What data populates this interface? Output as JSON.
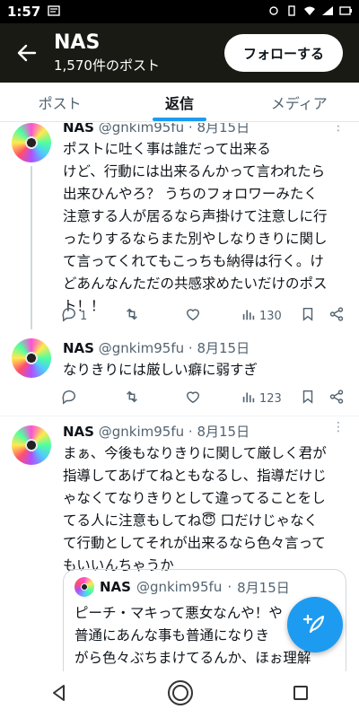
{
  "status_bar": {
    "time": "1:57"
  },
  "header": {
    "name": "NAS",
    "post_count": "1,570件のポスト",
    "follow_label": "フォローする"
  },
  "tabs": [
    {
      "label": "ポスト",
      "active": false
    },
    {
      "label": "返信",
      "active": true
    },
    {
      "label": "メディア",
      "active": false
    }
  ],
  "tweets": [
    {
      "display_name": "NAS",
      "handle": "@gnkim95fu",
      "date": "8月15日",
      "text_lines": [
        "ポストに吐く事は誰だって出来る",
        "けど、行動には出来るんかって言われたら",
        "出来ひんやろ？ うちのフォロワーみたく",
        "注意する人が居るなら声掛けて注意しに行",
        "ったりするならまた別やしなりきりに関し",
        "て言ってくれてもこっちも納得は行く。け",
        "どあんなんただの共感求めたいだけのポス",
        "ト！！"
      ],
      "replies": "1",
      "views": "130"
    },
    {
      "display_name": "NAS",
      "handle": "@gnkim95fu",
      "date": "8月15日",
      "text_lines": [
        "なりきりには厳しい癖に弱すぎ"
      ],
      "replies": "",
      "views": "123"
    },
    {
      "display_name": "NAS",
      "handle": "@gnkim95fu",
      "date": "8月15日",
      "text_lines": [
        "まぁ、今後もなりきりに関して厳しく君が",
        "指導してあげてねともなるし、指導だけじ",
        "ゃなくてなりきりとして違ってることをし",
        "てる人に注意もしてね😇 口だけじゃなく",
        "て行動としてそれが出来るなら色々言って",
        "もいいんちゃうか"
      ],
      "quote": {
        "display_name": "NAS",
        "handle": "@gnkim95fu",
        "date": "8月15日",
        "text_lines": [
          "ピーチ・マキって悪女なんや！や",
          "普通にあんな事も普通になりき",
          "がら色々ぶちまけてるんか、ほぉ理解"
        ]
      }
    }
  ],
  "colors": {
    "accent": "#1d9bf0",
    "header_bg": "#1a1a14"
  }
}
